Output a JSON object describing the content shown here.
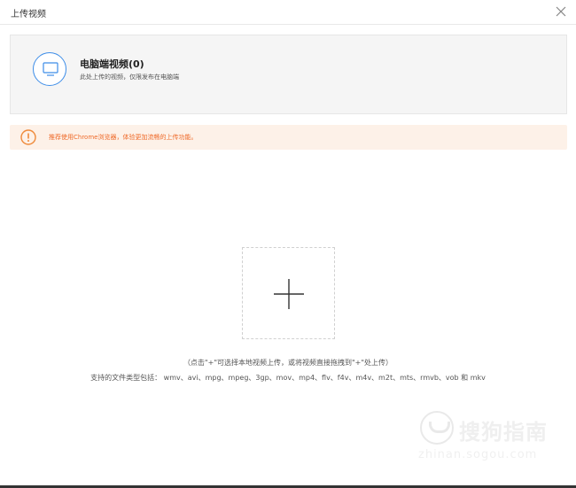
{
  "dialog": {
    "title": "上传视频",
    "close_icon": "close-icon"
  },
  "source": {
    "title": "电脑端视频(0)",
    "description": "此处上传的视频，仅限发布在电脑端",
    "icon": "monitor-icon",
    "accent": "#3d8de8"
  },
  "tip": {
    "icon": "warning-icon",
    "text": "推荐使用Chrome浏览器，体验更加流畅的上传功能。",
    "color": "#ef6a29",
    "background": "#fdf1e8"
  },
  "upload": {
    "icon": "plus-icon",
    "hint": "（点击\"+\"可选择本地视频上传，或将视频直接拖拽到\"+\"处上传）",
    "formats": "支持的文件类型包括： wmv、avi、mpg、mpeg、3gp、mov、mp4、flv、f4v、m4v、m2t、mts、rmvb、vob 和 mkv"
  },
  "watermark": {
    "brand": "搜狗指南",
    "url": "zhinan.sogou.com"
  }
}
